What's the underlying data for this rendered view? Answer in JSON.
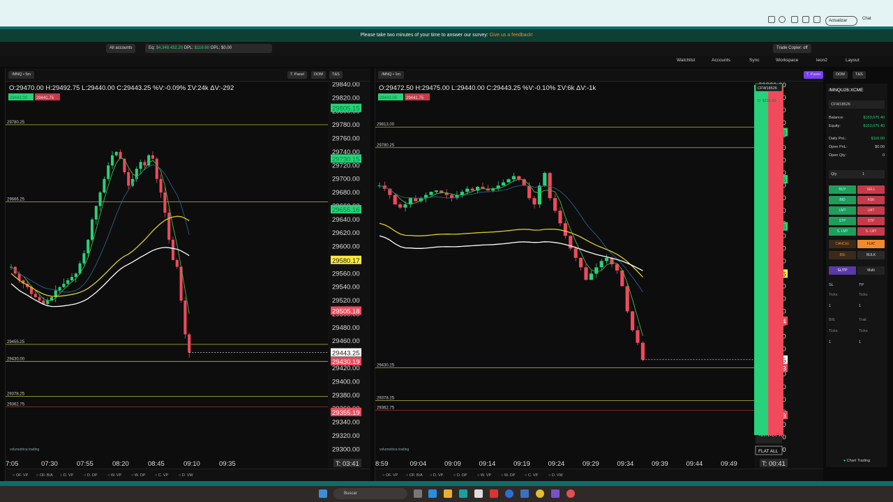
{
  "survey": {
    "text": "Please take two minutes of your time to answer our survey:",
    "link": "Give us a feedback!"
  },
  "browser": {
    "update_label": "Actualizar",
    "chat_label": "Chat"
  },
  "accounts": {
    "selector": "All accounts",
    "eq_label": "Eq:",
    "eq_value": "$4,348,432.20",
    "dpl_label": "DPL:",
    "dpl_value": "$116.60",
    "opl_label": "OPL:",
    "opl_value": "$0.00",
    "copier": "Trade Copier: off"
  },
  "toolbar": {
    "watchlist": "Watchlist",
    "accounts": "Accounts",
    "sync": "Sync",
    "workspace": "Workspace",
    "user": "leon2",
    "layout": "Layout"
  },
  "left": {
    "symbol": "/MNQ • 5m",
    "tpanel": "T. Panel",
    "dom": "DOM",
    "ts": "T&S",
    "ohlc": "O:29470.00  H:29492.75  L:29440.00  C:29443.25  %V:-0.09%  ΣV:24k  ΔV:-292",
    "bid_tag": "29442.00",
    "ask_tag": "29441.75",
    "timer": "T: 03:41",
    "brand": "volumetrica trading",
    "levels": [
      "29780.25",
      "29666.25",
      "29455.25",
      "29430.00",
      "29378.25",
      "29362.75"
    ],
    "right_tags": [
      "29805.15",
      "29730.15",
      "29655.16",
      "29580.17",
      "29505.18",
      "29443.25",
      "29430.19",
      "29355.19"
    ],
    "price_axis": [
      "29840.00",
      "29820.00",
      "29800.00",
      "29780.00",
      "29760.00",
      "29740.00",
      "29720.00",
      "29700.00",
      "29680.00",
      "29660.00",
      "29640.00",
      "29620.00",
      "29600.00",
      "29580.00",
      "29560.00",
      "29540.00",
      "29520.00",
      "29500.00",
      "29480.00",
      "29460.00",
      "29440.00",
      "29420.00",
      "29400.00",
      "29380.00",
      "29360.00",
      "29340.00",
      "29320.00",
      "29300.00"
    ],
    "time_axis": [
      "7:05",
      "07:30",
      "07:55",
      "08:20",
      "08:45",
      "09:10",
      "09:35"
    ],
    "studies": [
      "OF. VP",
      "OF. B/A",
      "D. VP",
      "D. DP",
      "W. VP",
      "W. DP",
      "C. VP",
      "D. VW"
    ]
  },
  "right": {
    "symbol": "/MNQ • 1m",
    "tpanel": "T. Panel",
    "dom": "DOM",
    "ts": "T&S",
    "ohlc": "O:29472.50  H:29475.00  L:29440.00  C:29443.25  %V:-0.10%  ΣV:6k  ΔV:-1k",
    "bid_tag": "29442.00",
    "ask_tag": "29441.75",
    "timer": "T: 00:41",
    "brand": "volumetrica trading",
    "levels": [
      "29813.00",
      "29780.25",
      "29430.25",
      "29378.25",
      "29362.75"
    ],
    "right_tags": [
      "29805.06",
      "29730.06",
      "29655.05",
      "29580.05",
      "29505.04",
      "29443.25",
      "29430.03",
      "29355.03"
    ],
    "price_axis": [
      "29880.00",
      "29860.00",
      "29840.00",
      "29820.00",
      "29800.00",
      "29780.00",
      "29760.00",
      "29740.00",
      "29720.00",
      "29700.00",
      "29680.00",
      "29660.00",
      "29640.00",
      "29620.00",
      "29600.00",
      "29580.00",
      "29560.00",
      "29540.00",
      "29520.00",
      "29500.00",
      "29480.00",
      "29460.00",
      "29440.00",
      "29420.00",
      "29400.00",
      "29380.00",
      "29360.00",
      "29340.00",
      "29320.00",
      "29300.00"
    ],
    "time_axis": [
      "8:59",
      "09:04",
      "09:09",
      "09:14",
      "09:19",
      "09:24",
      "09:29",
      "09:34",
      "09:39",
      "09:44",
      "09:49"
    ],
    "studies": [
      "OF. VP",
      "OF. B/A",
      "D. VP",
      "D. DP",
      "W. VP",
      "W. DP",
      "C. VP",
      "D. VW"
    ],
    "dom_account": "CFW18526",
    "dom_pnl": "D: $116.60",
    "flat_all": "FLAT ALL"
  },
  "panel": {
    "symbol": "/MNQU26:XCME",
    "account": "CFW18526",
    "balance_label": "Balance:",
    "balance": "$153,075.40",
    "equity_label": "Equity:",
    "equity": "$153,075.40",
    "dpnl_label": "Daily PnL:",
    "dpnl": "$116.60",
    "opnl_label": "Open PnL:",
    "opnl": "$0.00",
    "oqty_label": "Open Qty:",
    "oqty": "0",
    "qty_label": "Qty",
    "qty": "1",
    "buy": "BUY",
    "sell": "SELL",
    "bid": "BID",
    "ask": "ASK",
    "lmt": "LMT",
    "stp": "STP",
    "slmt": "S. LMT",
    "cancel": "CANCEL",
    "flat": "FLAT",
    "be": "B/E",
    "bulk": "BULK",
    "sltp": "SL/TP",
    "multi": "Multi",
    "sl": "SL",
    "tp": "TP",
    "ticks": "Ticks",
    "one": "1",
    "be2": "B/E",
    "trail": "Trail.",
    "chart_trading": "Chart Trading"
  },
  "taskbar": {
    "search": "Buscar"
  },
  "colors": {
    "up": "#27d27a",
    "down": "#f04a5c",
    "accent": "#f28a2b",
    "level": "#c8c84a"
  }
}
